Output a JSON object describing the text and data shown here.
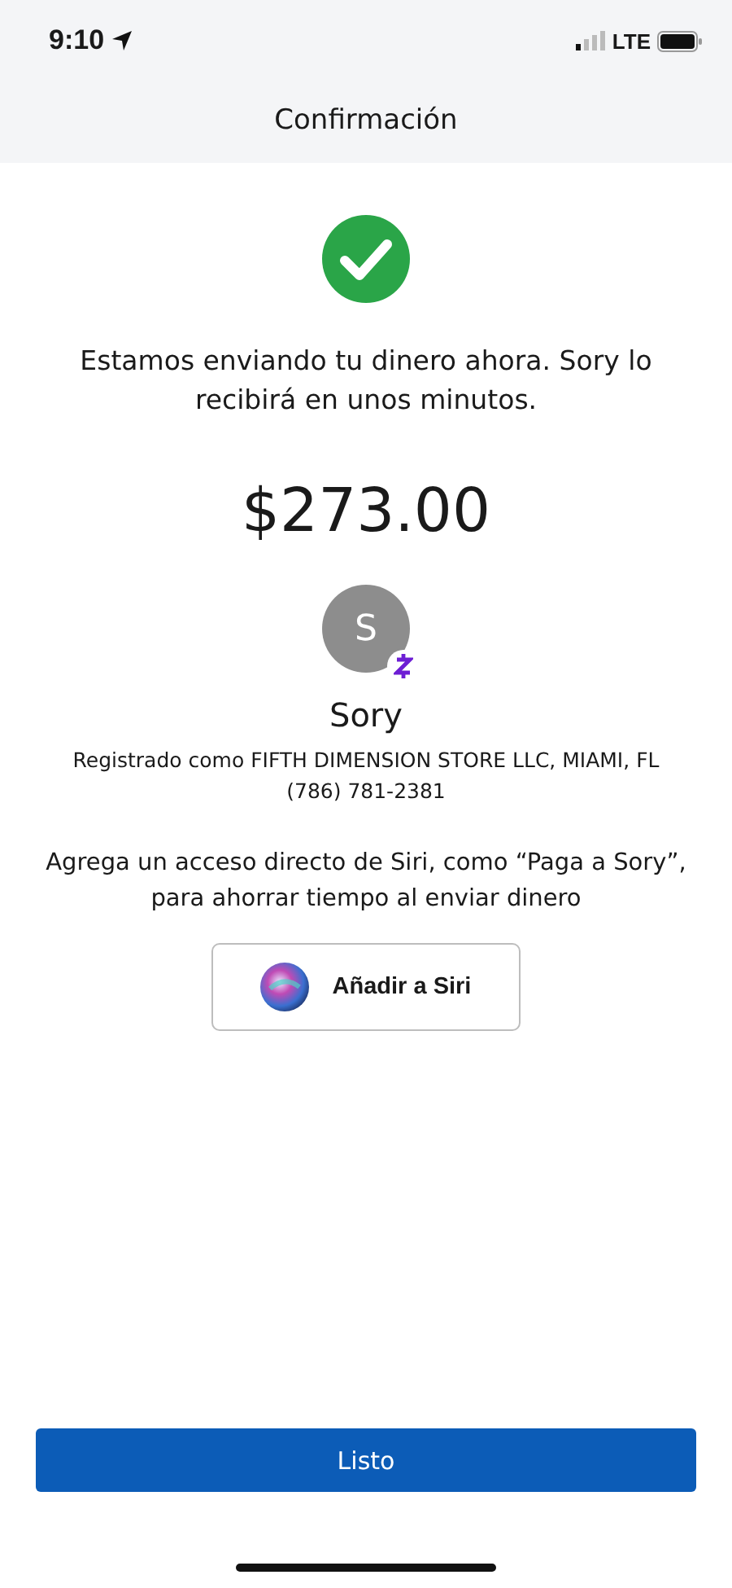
{
  "status_bar": {
    "time": "9:10",
    "network": "LTE"
  },
  "header": {
    "title": "Confirmación"
  },
  "message": "Estamos enviando tu dinero ahora. Sory lo recibirá en unos minutos.",
  "amount": "$273.00",
  "recipient": {
    "initial": "S",
    "name": "Sory",
    "registered": "Registrado como FIFTH DIMENSION STORE LLC, MIAMI, FL",
    "phone": "(786) 781-2381"
  },
  "siri": {
    "text": "Agrega un acceso directo de Siri, como “Paga a Sory”, para ahorrar tiempo al enviar dinero",
    "button": "Añadir a Siri"
  },
  "done_button": "Listo"
}
